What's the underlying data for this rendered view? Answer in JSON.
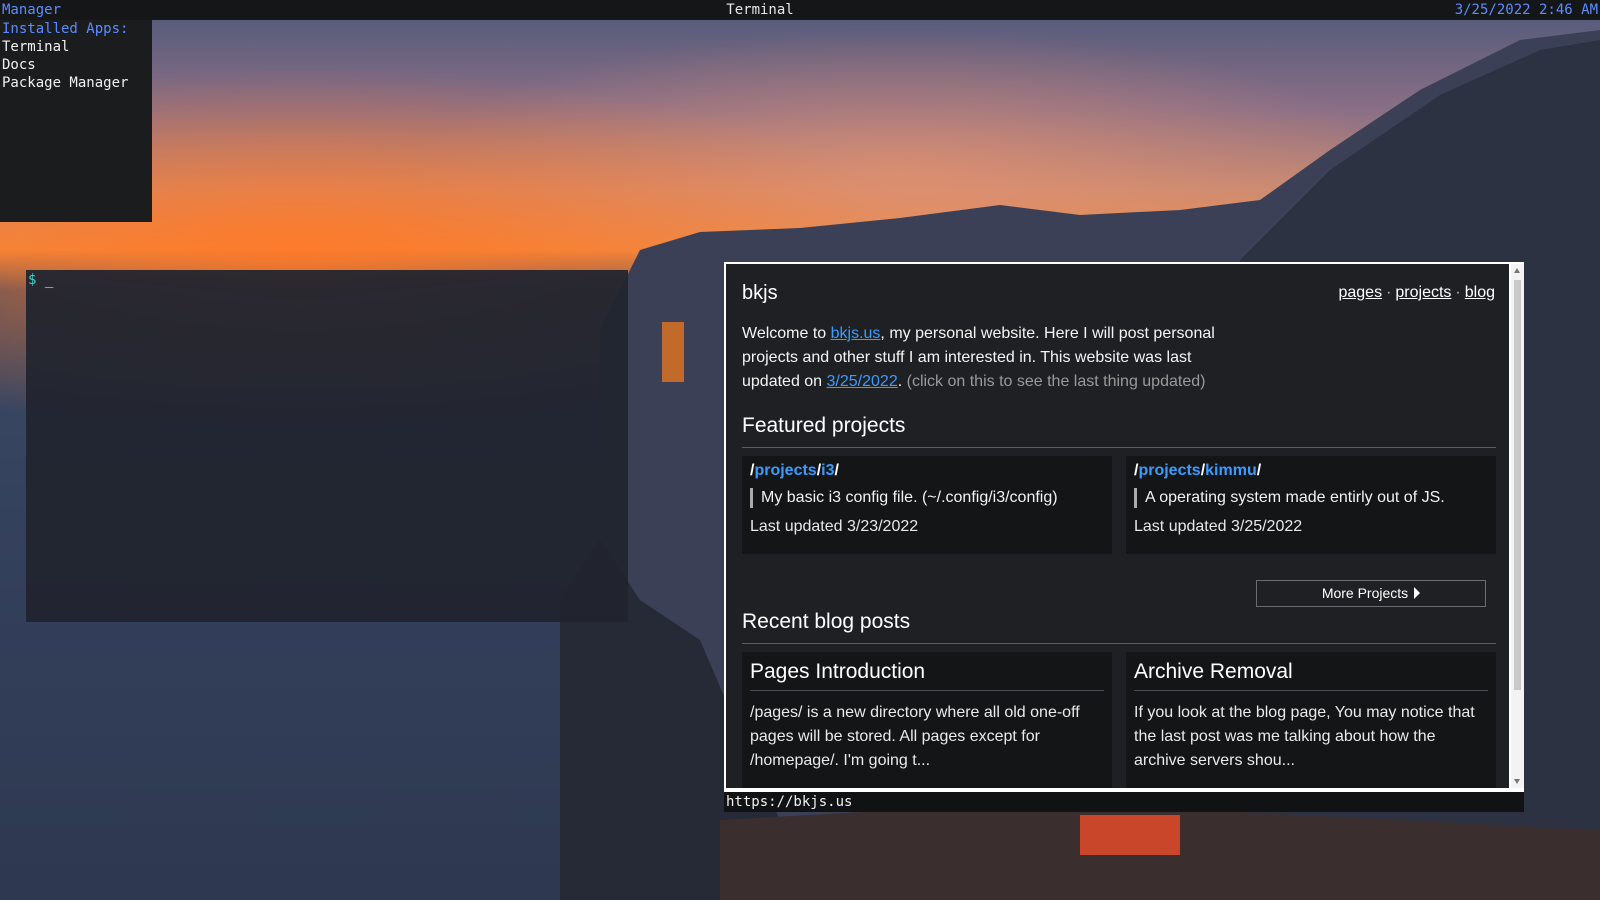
{
  "topbar": {
    "left_label": "Manager",
    "window_title": "Terminal",
    "datetime": "3/25/2022 2:46 AM"
  },
  "manager": {
    "header": "Installed Apps:",
    "apps": [
      "Terminal",
      "Docs",
      "Package Manager"
    ]
  },
  "terminal": {
    "prompt_symbol": "$",
    "cursor": "_"
  },
  "browser": {
    "site_title": "bkjs",
    "nav": [
      "pages",
      "projects",
      "blog"
    ],
    "nav_separator": "·",
    "intro": {
      "text1": "Welcome to ",
      "link1": "bkjs.us",
      "text2": ", my personal website. Here I will post personal projects and other stuff I am interested in. This website was last updated on ",
      "link2": "3/25/2022",
      "text3": ". ",
      "muted": "(click on this to see the last thing updated)"
    },
    "featured_heading": "Featured projects",
    "projects": [
      {
        "seg1": "projects",
        "seg2": "i3",
        "description": "My basic i3 config file. (~/.config/i3/config)",
        "updated": "Last updated 3/23/2022"
      },
      {
        "seg1": "projects",
        "seg2": "kimmu",
        "description": "A operating system made entirly out of JS.",
        "updated": "Last updated 3/25/2022"
      }
    ],
    "more_projects_label": "More Projects",
    "blog_heading": "Recent blog posts",
    "posts": [
      {
        "title": "Pages Introduction",
        "excerpt": "/pages/ is a new directory where all old one-off pages will be stored. All pages except for /homepage/. I'm going t..."
      },
      {
        "title": "Archive Removal",
        "excerpt": "If you look at the blog page, You may notice that the last post was me talking about how the archive servers shou..."
      }
    ],
    "status_url": "https://bkjs.us"
  }
}
